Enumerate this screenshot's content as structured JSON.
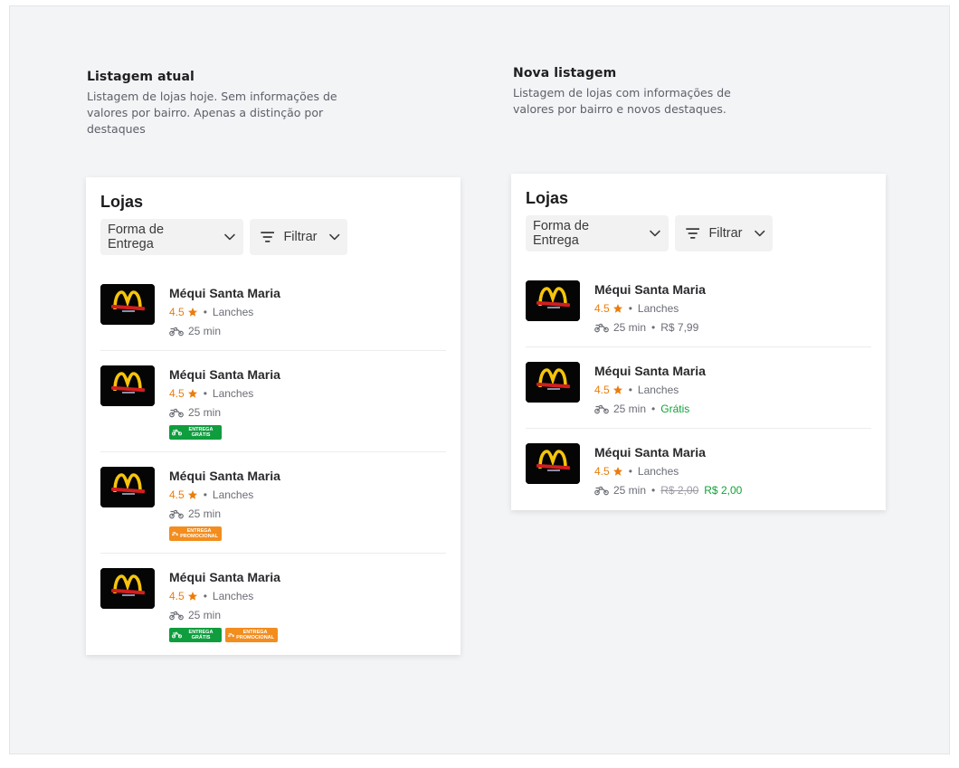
{
  "left": {
    "title": "Listagem atual",
    "description": "Listagem de lojas hoje. Sem informações de valores por bairro. Apenas a distinção por destaques",
    "card_title": "Lojas",
    "delivery_chip": "Forma de Entrega",
    "filter_chip": "Filtrar",
    "stores": [
      {
        "name": "Méqui Santa Maria",
        "rating": "4.5",
        "category": "Lanches",
        "time": "25 min"
      },
      {
        "name": "Méqui Santa Maria",
        "rating": "4.5",
        "category": "Lanches",
        "time": "25 min",
        "badge1": "ENTREGA GRÁTIS"
      },
      {
        "name": "Méqui Santa Maria",
        "rating": "4.5",
        "category": "Lanches",
        "time": "25 min",
        "badge1": "ENTREGA PROMOCIONAL"
      },
      {
        "name": "Méqui Santa Maria",
        "rating": "4.5",
        "category": "Lanches",
        "time": "25 min",
        "badge1": "ENTREGA GRÁTIS",
        "badge2": "ENTREGA PROMOCIONAL"
      }
    ]
  },
  "right": {
    "title": "Nova listagem",
    "description": "Listagem de lojas com informações de valores por bairro e novos destaques.",
    "card_title": "Lojas",
    "delivery_chip": "Forma de Entrega",
    "filter_chip": "Filtrar",
    "stores": [
      {
        "name": "Méqui Santa Maria",
        "rating": "4.5",
        "category": "Lanches",
        "time": "25 min",
        "fee": "R$ 7,99"
      },
      {
        "name": "Méqui Santa Maria",
        "rating": "4.5",
        "category": "Lanches",
        "time": "25 min",
        "fee": "Grátis"
      },
      {
        "name": "Méqui Santa Maria",
        "rating": "4.5",
        "category": "Lanches",
        "time": "25 min",
        "old_fee": "R$ 2,00",
        "fee": "R$ 2,00"
      }
    ]
  },
  "colors": {
    "rating": "#ea7d0c",
    "free_green": "#10a337",
    "badge_green": "#0f9d3e",
    "badge_orange": "#f28d1e",
    "background": "#f3f4f6"
  },
  "icons": [
    "chevron-down-icon",
    "filter-icon",
    "star-icon",
    "motorcycle-icon",
    "mcdonalds-logo"
  ]
}
